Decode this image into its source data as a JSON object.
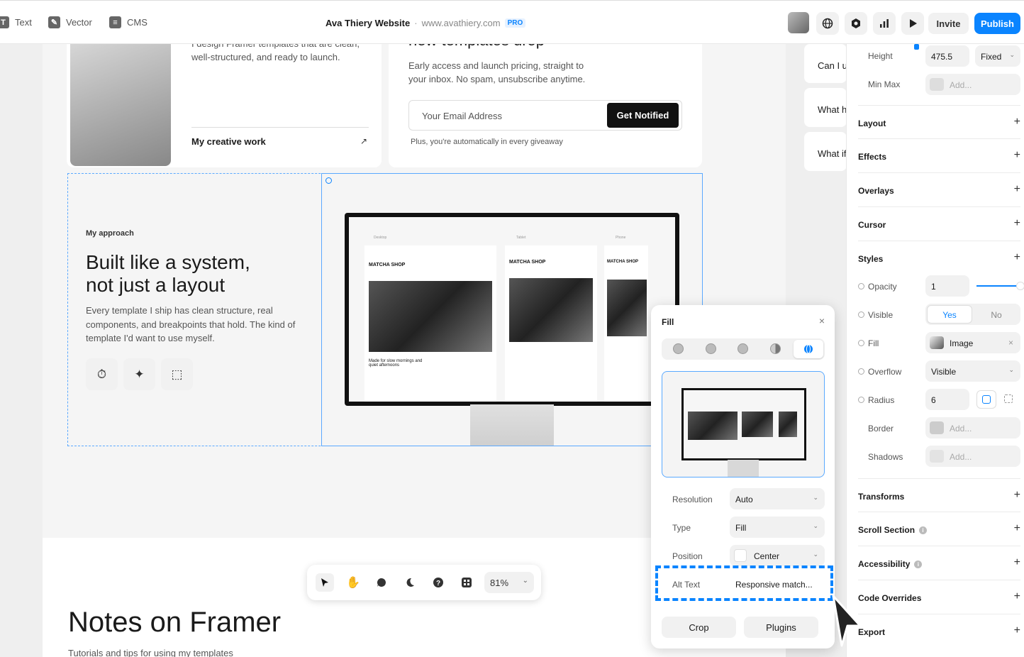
{
  "toolbar": {
    "tools": [
      {
        "label": "Text",
        "icon": "text-icon"
      },
      {
        "label": "Vector",
        "icon": "vector-icon"
      },
      {
        "label": "CMS",
        "icon": "cms-icon"
      }
    ],
    "project_title": "Ava Thiery Website",
    "separator": "·",
    "project_url": "www.avathiery.com",
    "plan_badge": "PRO",
    "invite_label": "Invite",
    "publish_label": "Publish"
  },
  "canvas": {
    "intro_text": "I design Framer templates that are clean, well-structured, and ready to launch.",
    "creative_link": "My creative work",
    "creative_arrow": "↗",
    "newsletter_title": "new templates drop",
    "newsletter_text": "Early access and launch pricing, straight to your inbox. No spam, unsubscribe anytime.",
    "email_placeholder": "Your Email Address",
    "notify_button": "Get Notified",
    "giveaway_note": "Plus, you're automatically in every giveaway",
    "approach_label": "My approach",
    "headline_line1": "Built like a system,",
    "headline_line2": "not just a layout",
    "approach_text": "Every template I ship has clean structure, real components, and breakpoints that hold. The kind of template I'd want to use myself.",
    "mock": {
      "tabs": [
        "Desktop",
        "Tablet",
        "Phone"
      ],
      "shop_name": "MATCHA SHOP",
      "caption": "Made for slow mornings and quiet afternoons"
    },
    "faq": [
      "Can I u",
      "What h",
      "What if"
    ],
    "notes_title": "Notes on Framer",
    "notes_sub": "Tutorials and tips for using my templates"
  },
  "bottom_toolbar": {
    "zoom": "81%"
  },
  "fill_popover": {
    "title": "Fill",
    "close": "×",
    "rows": [
      {
        "label": "Resolution",
        "value": "Auto"
      },
      {
        "label": "Type",
        "value": "Fill"
      },
      {
        "label": "Position",
        "value": "Center"
      },
      {
        "label": "Alt Text",
        "value": "Responsive match..."
      }
    ],
    "crop_label": "Crop",
    "plugins_label": "Plugins"
  },
  "right_panel": {
    "height_label": "Height",
    "height_value": "475.5",
    "height_mode": "Fixed",
    "minmax_label": "Min Max",
    "minmax_value": "Add...",
    "sections_top": [
      "Layout",
      "Effects",
      "Overlays",
      "Cursor",
      "Styles"
    ],
    "opacity_label": "Opacity",
    "opacity_value": "1",
    "opacity_level": 1,
    "visible_label": "Visible",
    "visible_yes": "Yes",
    "visible_no": "No",
    "fill_label": "Fill",
    "fill_value": "Image",
    "fill_clear": "×",
    "overflow_label": "Overflow",
    "overflow_value": "Visible",
    "radius_label": "Radius",
    "radius_value": "6",
    "border_label": "Border",
    "border_value": "Add...",
    "shadows_label": "Shadows",
    "shadows_value": "Add...",
    "sections_bottom": [
      "Transforms",
      "Scroll Section",
      "Accessibility",
      "Code Overrides",
      "Export"
    ]
  },
  "colors": {
    "accent": "#0a84ff",
    "dark": "#111111"
  }
}
